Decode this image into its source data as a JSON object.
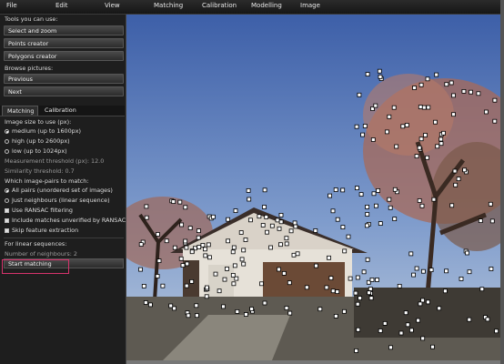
{
  "menu": [
    "File",
    "Edit",
    "View",
    "Matching",
    "Calibration",
    "Modelling",
    "Image"
  ],
  "sidebar": {
    "tools_header": "Tools you can use:",
    "tools": [
      "Select and zoom",
      "Points creator",
      "Polygons creator"
    ],
    "browse_header": "Browse pictures:",
    "browse": [
      "Previous",
      "Next"
    ],
    "tabs": [
      "Matching",
      "Calibration"
    ],
    "image_size_header": "Image size to use (px):",
    "image_size_options": [
      {
        "label": "medium (up to 1600px)",
        "selected": true
      },
      {
        "label": "high (up to 2600px)",
        "selected": false
      },
      {
        "label": "low (up to 1024px)",
        "selected": false
      }
    ],
    "measurement_threshold": "Measurement threshold (px): 12.0",
    "similarity_threshold": "Similarity threshold: 0.7",
    "pairs_header": "Which image-pairs to match:",
    "pairs_options": [
      {
        "label": "All pairs (unordered set of images)",
        "selected": true
      },
      {
        "label": "Just neighbours (linear sequence)",
        "selected": false
      }
    ],
    "checkboxes": [
      "Use RANSAC filtering",
      "Include matches unverified by RANSAC",
      "Skip feature extraction"
    ],
    "linear_header": "For linear sequences:",
    "neighbours": "Number of neighbours: 2",
    "start_button": "Start matching"
  },
  "photo": {
    "watermark": "",
    "description_icon": "photo-viewport"
  }
}
